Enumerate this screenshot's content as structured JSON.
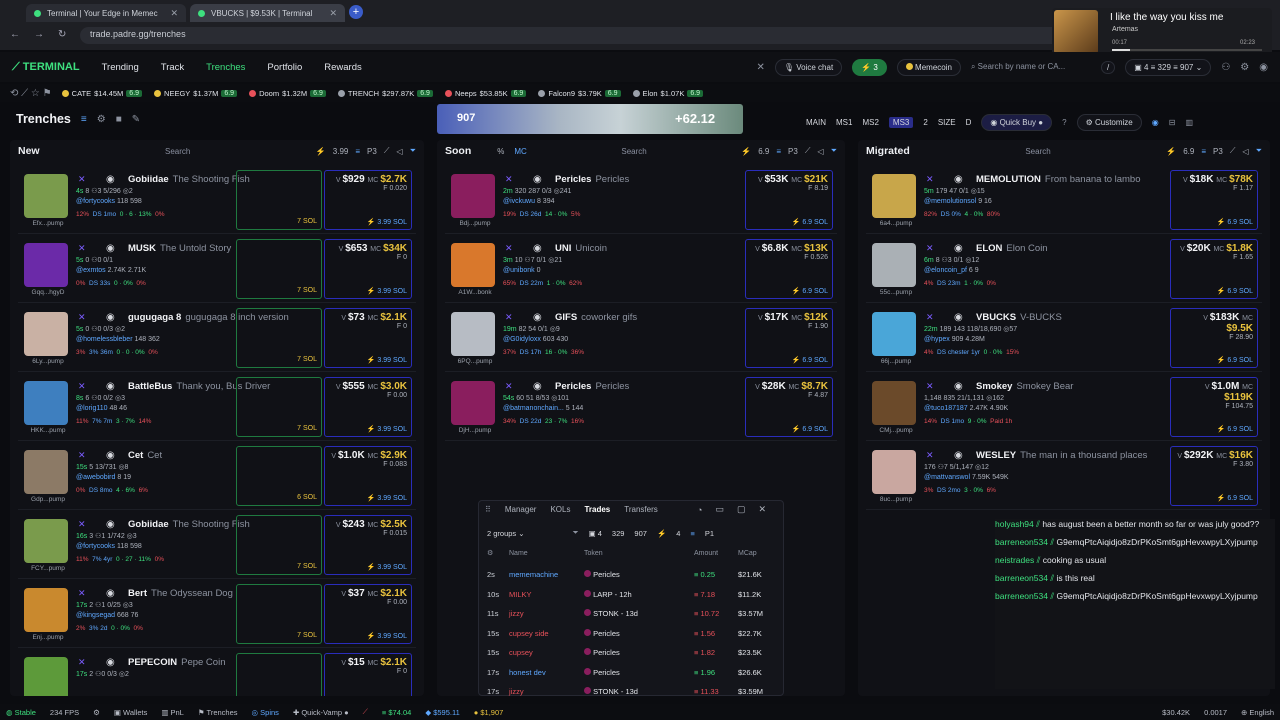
{
  "browser": {
    "tabs": [
      {
        "label": "Terminal | Your Edge in Memec"
      },
      {
        "label": "VBUCKS | $9.53K | Terminal"
      }
    ],
    "url": "trade.padre.gg/trenches"
  },
  "video": {
    "title": "I like the way you kiss me",
    "artist": "Artemas",
    "elapsed": "00:17",
    "duration": "02:23"
  },
  "appbar": {
    "brand": "TERMINAL",
    "nav": [
      "Trending",
      "Track",
      "Trenches",
      "Portfolio",
      "Rewards"
    ],
    "voice_chat": "Voice chat",
    "badge_count": "3",
    "memecoin": "Memecoin",
    "search_placeholder": "Search by name or CA...",
    "slash": "/",
    "wallet_count": "4",
    "wallet_a": "329",
    "wallet_b": "907"
  },
  "ticker": [
    {
      "name": "CATE",
      "mc": "$14.45M",
      "chg": "6.9",
      "color": "#e8c23e"
    },
    {
      "name": "NEEGY",
      "mc": "$1.37M",
      "chg": "6.9",
      "color": "#e8c23e"
    },
    {
      "name": "Doom",
      "mc": "$1.32M",
      "chg": "6.9",
      "color": "#e8515a"
    },
    {
      "name": "TRENCH",
      "mc": "$297.87K",
      "chg": "6.9",
      "color": "#9aa0aa"
    },
    {
      "name": "Neeps",
      "mc": "$53.85K",
      "chg": "6.9",
      "color": "#e8515a"
    },
    {
      "name": "Falcon9",
      "mc": "$3.79K",
      "chg": "6.9",
      "color": "#9aa0aa"
    },
    {
      "name": "Elon",
      "mc": "$1.07K",
      "chg": "6.9",
      "color": "#9aa0aa"
    }
  ],
  "banner": {
    "left": "907",
    "right": "+62.12"
  },
  "page": {
    "title": "Trenches",
    "modes": [
      "MAIN",
      "MS1",
      "MS2",
      "MS3",
      "2",
      "SIZE",
      "D"
    ],
    "quick_buy": "Quick Buy",
    "customize": "Customize"
  },
  "columns": [
    {
      "title": "New",
      "search": "Search",
      "amount": "3.99",
      "preset": "P3",
      "cards": [
        {
          "name": "Gobiidae",
          "sub": "The Shooting Fish",
          "age": "4s",
          "stats": "8  ⚇3  5/296  ◎2",
          "handle": "@fortycooks",
          "followers": "118  598",
          "foot": [
            "12%",
            "DS 1mo",
            "0 · 6 · 13%",
            "0%"
          ],
          "v": "$929",
          "mc": "$2.7K",
          "f": "0.020",
          "sol": "3.99 SOL",
          "av": "#7a9b4c",
          "lab": "Efx...pump",
          "right": "7 SOL"
        },
        {
          "name": "MUSK",
          "sub": "The Untold Story",
          "age": "5s",
          "stats": "0  ⚇0  0/1",
          "handle": "@exmtos",
          "followers": "2.74K  2.71K",
          "foot": [
            "0%",
            "DS 33s",
            "0 · 0%",
            "0%"
          ],
          "v": "$653",
          "mc": "$34K",
          "f": "0",
          "sol": "3.99 SOL",
          "av": "#6b2aa8",
          "lab": "Gqq...hgyD",
          "right": "7 SOL"
        },
        {
          "name": "gugugaga 8",
          "sub": "gugugaga 8 inch version",
          "age": "5s",
          "stats": "0  ⚇0  0/3  ◎2",
          "handle": "@homelessbleber",
          "followers": "148  362",
          "foot": [
            "3%",
            "3% 36m",
            "0 · 0 · 0%",
            "0%"
          ],
          "v": "$73",
          "mc": "$2.1K",
          "f": "0",
          "sol": "3.99 SOL",
          "av": "#c9b1a4",
          "lab": "6Ly...pump",
          "right": "7 SOL"
        },
        {
          "name": "BattleBus",
          "sub": "Thank you, Bus Driver",
          "age": "8s",
          "stats": "6  ⚇0  0/2  ◎3",
          "handle": "@lorig110",
          "followers": "48  46",
          "foot": [
            "11%",
            "7% 7m",
            "3 · 7%",
            "14%"
          ],
          "v": "$555",
          "mc": "$3.0K",
          "f": "0.00",
          "sol": "3.99 SOL",
          "av": "#3e7fbf",
          "lab": "HKK...pump",
          "right": "7 SOL"
        },
        {
          "name": "Cet",
          "sub": "Cet",
          "age": "15s",
          "stats": "5  13/731  ◎8",
          "handle": "@awebobird",
          "followers": "8  19",
          "foot": [
            "0%",
            "DS 8mo",
            "4 · 6%",
            "6%"
          ],
          "v": "$1.0K",
          "mc": "$2.9K",
          "f": "0.083",
          "sol": "3.99 SOL",
          "av": "#8c7a66",
          "lab": "Gdp...pump",
          "right": "6 SOL"
        },
        {
          "name": "Gobiidae",
          "sub": "The Shooting Fish",
          "age": "16s",
          "stats": "3  ⚇1  1/742  ◎3",
          "handle": "@fortycooks",
          "followers": "118  598",
          "foot": [
            "11%",
            "7% 4yr",
            "0 · 27 · 11%",
            "0%"
          ],
          "v": "$243",
          "mc": "$2.5K",
          "f": "0.015",
          "sol": "3.99 SOL",
          "av": "#7a9b4c",
          "lab": "FCY...pump",
          "right": "7 SOL"
        },
        {
          "name": "Bert",
          "sub": "The Odyssean Dog",
          "age": "17s",
          "stats": "2  ⚇1  0/25  ◎3",
          "handle": "@kingsegad",
          "followers": "668  76",
          "foot": [
            "2%",
            "3% 2d",
            "0 · 0%",
            "0%"
          ],
          "v": "$37",
          "mc": "$2.1K",
          "f": "0.00",
          "sol": "3.99 SOL",
          "av": "#c9892e",
          "lab": "Enj...pump",
          "right": "7 SOL"
        },
        {
          "name": "PEPECOIN",
          "sub": "Pepe Coin",
          "age": "17s",
          "stats": "2  ⚇0  0/3  ◎2",
          "handle": "",
          "followers": "",
          "foot": [
            "",
            "",
            "",
            ""
          ],
          "v": "$15",
          "mc": "$2.1K",
          "f": "0",
          "sol": "",
          "av": "#5d9a3a",
          "lab": "",
          "right": ""
        }
      ]
    },
    {
      "title": "Soon",
      "search": "Search",
      "amount": "6.9",
      "preset": "P3",
      "pct": "%",
      "mcl": "MC",
      "cards": [
        {
          "name": "Pericles",
          "sub": "Pericles",
          "age": "2m",
          "stats": "320  287  0/3  ◎241",
          "handle": "@ivckuwu",
          "followers": "8  394",
          "foot": [
            "19%",
            "DS 26d",
            "14 · 0%",
            "5%"
          ],
          "v": "$53K",
          "mc": "$21K",
          "f": "8.19",
          "sol": "6.9 SOL",
          "av": "#8a1e5e",
          "lab": "Bdj...pump",
          "right": ""
        },
        {
          "name": "UNI",
          "sub": "Unicoin",
          "age": "3m",
          "stats": "10  ⚇7  0/1  ◎21",
          "handle": "@unibonk",
          "followers": "0",
          "foot": [
            "65%",
            "DS 22m",
            "1 · 0%",
            "62%"
          ],
          "v": "$6.8K",
          "mc": "$13K",
          "f": "0.526",
          "sol": "6.9 SOL",
          "av": "#d9782c",
          "lab": "A1W...bonk",
          "right": ""
        },
        {
          "name": "GIFS",
          "sub": "coworker gifs",
          "age": "19m",
          "stats": "82  54  0/1  ◎9",
          "handle": "@G0idyloxx",
          "followers": "603  430",
          "foot": [
            "37%",
            "DS 17h",
            "16 · 0%",
            "36%"
          ],
          "v": "$17K",
          "mc": "$12K",
          "f": "1.90",
          "sol": "6.9 SOL",
          "av": "#b7bcc4",
          "lab": "6PQ...pump",
          "right": ""
        },
        {
          "name": "Pericles",
          "sub": "Pericles",
          "age": "54s",
          "stats": "60  51  8/53  ◎101",
          "handle": "@batmanonchain...",
          "followers": "5  144",
          "foot": [
            "34%",
            "DS 22d",
            "23 · 7%",
            "16%"
          ],
          "v": "$28K",
          "mc": "$8.7K",
          "f": "4.87",
          "sol": "6.9 SOL",
          "av": "#8a1e5e",
          "lab": "DjH...pump",
          "right": ""
        }
      ]
    },
    {
      "title": "Migrated",
      "search": "Search",
      "amount": "6.9",
      "preset": "P3",
      "cards": [
        {
          "name": "MEMOLUTION",
          "sub": "From banana to lambo",
          "age": "5m",
          "stats": "179  47  0/1  ◎15",
          "handle": "@memolutionsol",
          "followers": "9  16",
          "foot": [
            "82%",
            "DS 0%",
            "4 · 0%",
            "80%"
          ],
          "v": "$18K",
          "mc": "$78K",
          "f": "1.17",
          "sol": "6.9 SOL",
          "av": "#c8a64a",
          "lab": "6a4...pump",
          "right": ""
        },
        {
          "name": "ELON",
          "sub": "Elon Coin",
          "age": "6m",
          "stats": "8  ⚇3  0/1  ◎12",
          "handle": "@eloncoin_pf",
          "followers": "6  9",
          "foot": [
            "4%",
            "DS 23m",
            "1 · 0%",
            "0%"
          ],
          "v": "$20K",
          "mc": "$1.8K",
          "f": "1.65",
          "sol": "6.9 SOL",
          "av": "#aab0b5",
          "lab": "55c...pump",
          "right": ""
        },
        {
          "name": "VBUCKS",
          "sub": "V-BUCKS",
          "age": "22m",
          "stats": "189  143  118/18,690  ◎57",
          "handle": "@hypex",
          "followers": "909  4.28M",
          "foot": [
            "4%",
            "DS chester 1yr",
            "0 · 0%",
            "15%"
          ],
          "v": "$183K",
          "mc": "$9.5K",
          "f": "28.90",
          "sol": "6.9 SOL",
          "av": "#4aa6d8",
          "lab": "66j...pump",
          "right": ""
        },
        {
          "name": "Smokey",
          "sub": "Smokey Bear",
          "age": "",
          "stats": "1,148  835  21/1,131  ◎162",
          "handle": "@tuco187187",
          "followers": "2.47K  4.90K",
          "foot": [
            "14%",
            "DS 1mo",
            "9 · 0%",
            "Paid 1h"
          ],
          "v": "$1.0M",
          "mc": "$119K",
          "f": "104.75",
          "sol": "6.9 SOL",
          "av": "#6b4a2a",
          "lab": "CMj...pump",
          "right": ""
        },
        {
          "name": "WESLEY",
          "sub": "The man in a thousand places",
          "age": "",
          "stats": "176  ⚇7  5/1,147  ◎12",
          "handle": "@mattvanswol",
          "followers": "7.59K  549K",
          "foot": [
            "3%",
            "DS 2mo",
            "3 · 0%",
            "6%"
          ],
          "v": "$292K",
          "mc": "$16K",
          "f": "3.80",
          "sol": "6.9 SOL",
          "av": "#c9a7a0",
          "lab": "8uc...pump",
          "right": ""
        }
      ]
    }
  ],
  "trades": {
    "tabs": [
      "Manager",
      "KOLs",
      "Trades",
      "Transfers"
    ],
    "groups": "2 groups",
    "counts": [
      "4",
      "329",
      "907",
      "4",
      "P1"
    ],
    "headers": [
      "Name",
      "Token",
      "Amount",
      "MCap"
    ],
    "rows": [
      {
        "t": "2s",
        "name": "mememachine",
        "token": "Pericles",
        "amt": "0.25",
        "mcap": "$21.6K",
        "side": "buy"
      },
      {
        "t": "10s",
        "name": "MILKY",
        "token": "LARP - 12h",
        "amt": "7.18",
        "mcap": "$11.2K",
        "side": "sell"
      },
      {
        "t": "11s",
        "name": "jizzy",
        "token": "STONK - 13d",
        "amt": "10.72",
        "mcap": "$3.57M",
        "side": "sell"
      },
      {
        "t": "15s",
        "name": "cupsey side",
        "token": "Pericles",
        "amt": "1.56",
        "mcap": "$22.7K",
        "side": "sell"
      },
      {
        "t": "15s",
        "name": "cupsey",
        "token": "Pericles",
        "amt": "1.82",
        "mcap": "$23.5K",
        "side": "sell"
      },
      {
        "t": "17s",
        "name": "honest dev",
        "token": "Pericles",
        "amt": "1.96",
        "mcap": "$26.6K",
        "side": "buy"
      },
      {
        "t": "17s",
        "name": "jizzy",
        "token": "STONK - 13d",
        "amt": "11.33",
        "mcap": "$3.59M",
        "side": "sell"
      }
    ]
  },
  "chat": [
    {
      "user": "holyash94",
      "text": "has august been a better month so far or was july good??"
    },
    {
      "user": "barreneon534",
      "text": "G9emqPtcAiqidjo8zDrPKoSmt6gpHevxwpyLXyjpump"
    },
    {
      "user": "neistrades",
      "text": "cooking as usual"
    },
    {
      "user": "barreneon534",
      "text": "is this real"
    },
    {
      "user": "barreneon534",
      "text": "G9emqPtcAiqidjo8zDrPKoSmt6gpHevxwpyLXyjpump"
    }
  ],
  "status": {
    "stable": "Stable",
    "fps": "234 FPS",
    "wallets": "Wallets",
    "pnl": "PnL",
    "trenches": "Trenches",
    "spins": "Spins",
    "quick_vamp": "Quick-Vamp",
    "sol_price": "$74.04",
    "eth_price": "$595.11",
    "btc_price": "$1,907",
    "right_a": "$30.42K",
    "right_b": "0.0017",
    "lang": "English"
  }
}
